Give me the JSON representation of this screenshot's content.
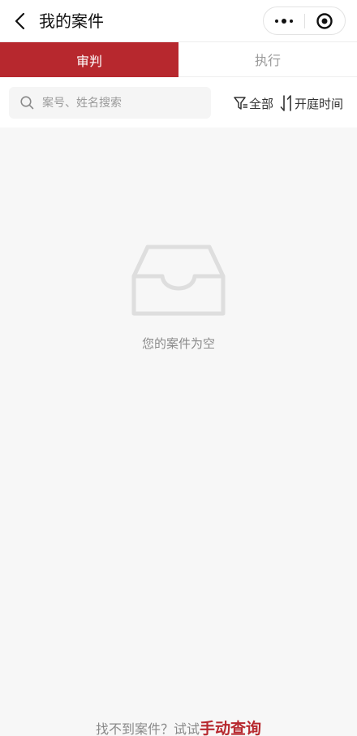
{
  "header": {
    "title": "我的案件",
    "back_icon": "chevron-left-icon",
    "more_icon": "more-dots-icon",
    "close_icon": "target-icon"
  },
  "tabs": [
    {
      "label": "审判",
      "active": true
    },
    {
      "label": "执行",
      "active": false
    }
  ],
  "filter": {
    "search_placeholder": "案号、姓名搜索",
    "filter_label": "全部",
    "sort_label": "开庭时间"
  },
  "empty": {
    "text": "您的案件为空",
    "icon": "inbox-icon"
  },
  "bottom": {
    "hint": "找不到案件？试试",
    "link": "手动查询"
  },
  "colors": {
    "brand": "#b7282e",
    "background": "#f7f7f7"
  }
}
